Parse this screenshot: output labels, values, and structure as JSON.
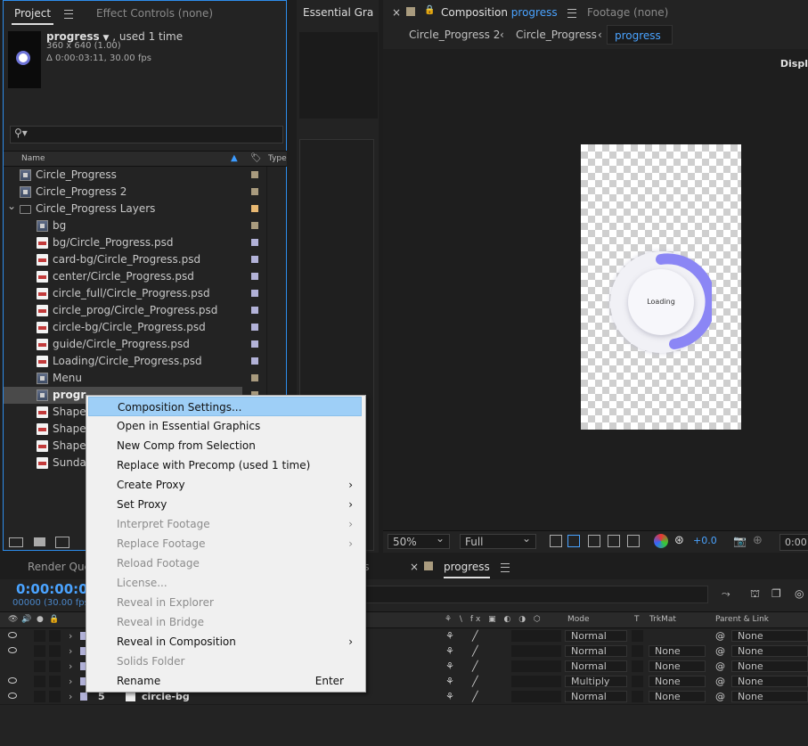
{
  "project": {
    "tab_label": "Project",
    "effect_tab": "Effect Controls (none)",
    "item_name": "progress",
    "used_text": ", used 1 time",
    "dims": "360 x 640 (1.00)",
    "duration": "Δ 0:00:03:11, 30.00 fps",
    "col_name": "Name",
    "col_type": "Type",
    "items": [
      {
        "name": "Circle_Progress",
        "icon": "comp",
        "indent": 0,
        "label_color": "#a99b7e"
      },
      {
        "name": "Circle_Progress 2",
        "icon": "comp",
        "indent": 0,
        "label_color": "#a99b7e"
      },
      {
        "name": "Circle_Progress Layers",
        "icon": "folder",
        "indent": 0,
        "label_color": "#e8b872"
      },
      {
        "name": "bg",
        "icon": "comp",
        "indent": 1,
        "label_color": "#a99b7e"
      },
      {
        "name": "bg/Circle_Progress.psd",
        "icon": "psd",
        "indent": 1,
        "label_color": "#b2b2d8"
      },
      {
        "name": "card-bg/Circle_Progress.psd",
        "icon": "psd",
        "indent": 1,
        "label_color": "#b2b2d8"
      },
      {
        "name": "center/Circle_Progress.psd",
        "icon": "psd",
        "indent": 1,
        "label_color": "#b2b2d8"
      },
      {
        "name": "circle_full/Circle_Progress.psd",
        "icon": "psd",
        "indent": 1,
        "label_color": "#b2b2d8"
      },
      {
        "name": "circle_prog/Circle_Progress.psd",
        "icon": "psd",
        "indent": 1,
        "label_color": "#b2b2d8"
      },
      {
        "name": "circle-bg/Circle_Progress.psd",
        "icon": "psd",
        "indent": 1,
        "label_color": "#b2b2d8"
      },
      {
        "name": "guide/Circle_Progress.psd",
        "icon": "psd",
        "indent": 1,
        "label_color": "#b2b2d8"
      },
      {
        "name": "Loading/Circle_Progress.psd",
        "icon": "psd",
        "indent": 1,
        "label_color": "#b2b2d8"
      },
      {
        "name": "Menu",
        "icon": "comp",
        "indent": 1,
        "label_color": "#a99b7e"
      },
      {
        "name": "progr",
        "icon": "comp",
        "indent": 1,
        "label_color": "#a99b7e",
        "selected": true
      },
      {
        "name": "Shape",
        "icon": "psd",
        "indent": 1,
        "label_color": "#b2b2d8"
      },
      {
        "name": "Shape",
        "icon": "psd",
        "indent": 1,
        "label_color": "#b2b2d8"
      },
      {
        "name": "Shape",
        "icon": "psd",
        "indent": 1,
        "label_color": "#b2b2d8"
      },
      {
        "name": "Sunda",
        "icon": "psd",
        "indent": 1,
        "label_color": "#b2b2d8"
      }
    ]
  },
  "essential": {
    "tab_label": "Essential Gra"
  },
  "comp": {
    "tab_label": "Composition",
    "tab_name": "progress",
    "footage_tab": "Footage (none)",
    "crumbs": [
      "Circle_Progress 2",
      "Circle_Progress",
      "progress"
    ],
    "display_text": "Displ",
    "loading_text": "Loading",
    "zoom": "50%",
    "resolution": "Full",
    "exposure": "+0.0",
    "timecode_short": "0:00:"
  },
  "timeline": {
    "render_queue_tab": "Render Queu",
    "comp_tab": "progress",
    "partial_tab": "ss",
    "timecode": "0:00:00:00",
    "frames": "00000 (30.00 fps",
    "col_mode": "Mode",
    "col_t": "T",
    "col_trkmat": "TrkMat",
    "col_parent": "Parent & Link",
    "layers": [
      {
        "mode": "Normal",
        "trkmat": "",
        "parent": "None",
        "eye": true
      },
      {
        "mode": "Normal",
        "trkmat": "None",
        "parent": "None",
        "eye": true
      },
      {
        "mode": "Normal",
        "trkmat": "None",
        "parent": "None",
        "eye": false
      },
      {
        "mode": "Multiply",
        "trkmat": "None",
        "parent": "None",
        "eye": true
      },
      {
        "mode": "Normal",
        "trkmat": "None",
        "parent": "None",
        "eye": true,
        "num": "5",
        "name": "circle-bg"
      }
    ]
  },
  "menu": {
    "items": [
      {
        "label": "Composition Settings...",
        "disabled": false,
        "highlighted": true
      },
      {
        "label": "Open in Essential Graphics",
        "disabled": false
      },
      {
        "label": "New Comp from Selection",
        "disabled": false
      },
      {
        "label": "Replace with Precomp (used 1 time)",
        "disabled": false
      },
      {
        "label": "Create Proxy",
        "disabled": false,
        "submenu": true
      },
      {
        "label": "Set Proxy",
        "disabled": false,
        "submenu": true
      },
      {
        "label": "Interpret Footage",
        "disabled": true,
        "submenu": true
      },
      {
        "label": "Replace Footage",
        "disabled": true,
        "submenu": true
      },
      {
        "label": "Reload Footage",
        "disabled": true
      },
      {
        "label": "License...",
        "disabled": true
      },
      {
        "label": "Reveal in Explorer",
        "disabled": true
      },
      {
        "label": "Reveal in Bridge",
        "disabled": true
      },
      {
        "label": "Reveal in Composition",
        "disabled": false,
        "submenu": true
      },
      {
        "label": "Solids Folder",
        "disabled": true
      },
      {
        "label": "Rename",
        "disabled": false,
        "shortcut": "Enter"
      }
    ]
  },
  "colors": {
    "accent": "#2d8ceb",
    "progress_arc": "#8b86f5",
    "menu_highlight": "#9ecff7"
  }
}
